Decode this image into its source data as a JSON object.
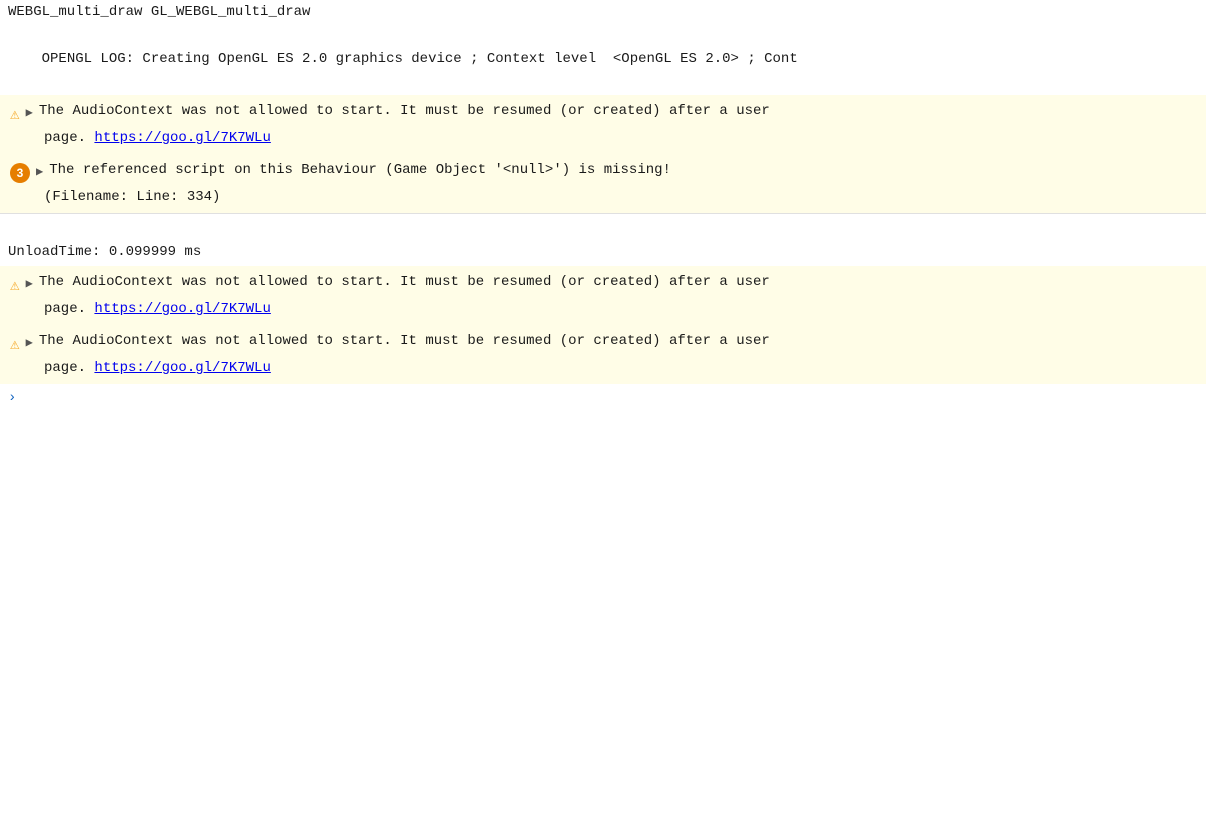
{
  "console": {
    "webgl_line": "WEBGL_multi_draw GL_WEBGL_multi_draw",
    "opengl_line": "OPENGL LOG: Creating OpenGL ES 2.0 graphics device ; Context level  <OpenGL ES 2.0> ; Cont",
    "warning1": {
      "icon": "⚠",
      "arrow": "▶",
      "message": "The AudioContext was not allowed to start. It must be resumed (or created) after a user",
      "page_label": "page.",
      "link_text": "https://goo.gl/7K7WLu",
      "link_href": "https://goo.gl/7K7WLu"
    },
    "error1": {
      "badge": "3",
      "arrow": "▶",
      "message": "The referenced script on this Behaviour (Game Object '<null>') is missing!",
      "detail": "(Filename:  Line: 334)"
    },
    "unload_line": "UnloadTime: 0.099999 ms",
    "warning2": {
      "icon": "⚠",
      "arrow": "▶",
      "message": "The AudioContext was not allowed to start. It must be resumed (or created) after a user",
      "page_label": "page.",
      "link_text": "https://goo.gl/7K7WLu",
      "link_href": "https://goo.gl/7K7WLu"
    },
    "warning3": {
      "icon": "⚠",
      "arrow": "▶",
      "message": "The AudioContext was not allowed to start. It must be resumed (or created) after a user",
      "page_label": "page.",
      "link_text": "https://goo.gl/7K7WLu",
      "link_href": "https://goo.gl/7K7WLu"
    },
    "chevron": "›"
  }
}
